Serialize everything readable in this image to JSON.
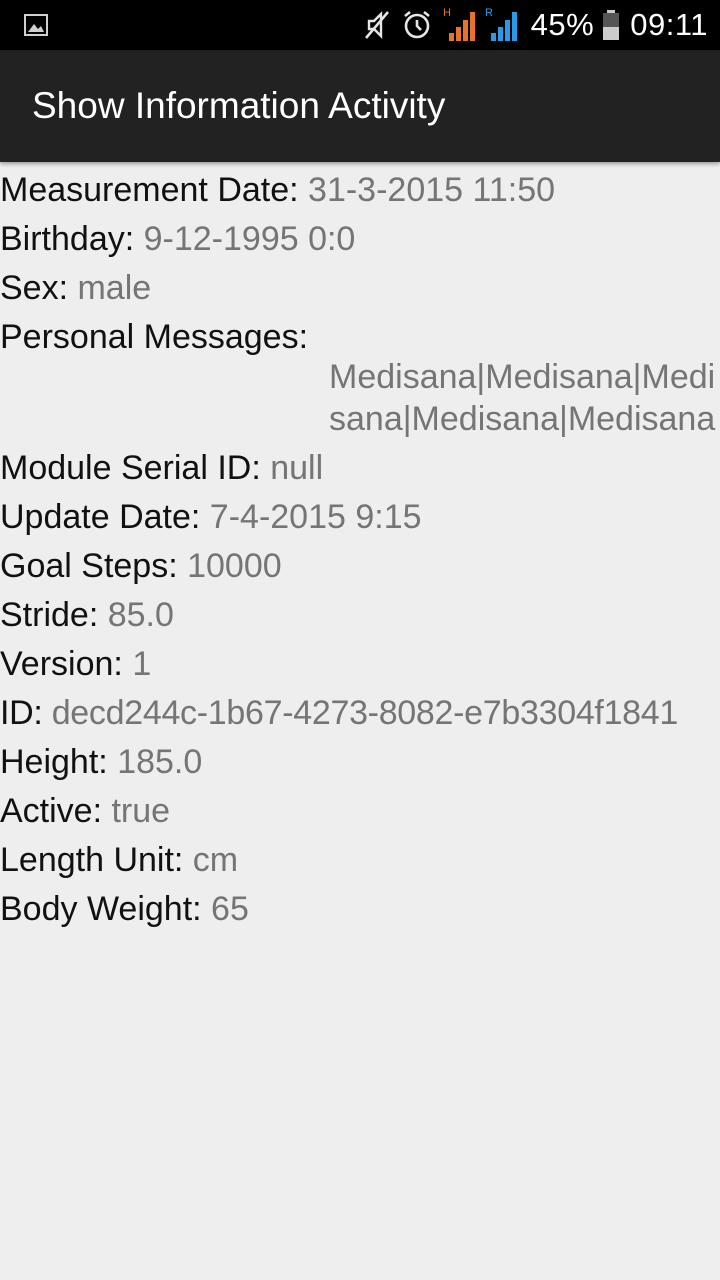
{
  "status_bar": {
    "icons": [
      "image-notification-icon",
      "mute-icon",
      "alarm-icon",
      "signal-h-icon",
      "signal-r-icon",
      "battery-icon"
    ],
    "signal_1_letter": "H",
    "signal_2_letter": "R",
    "battery": "45%",
    "time": "09:11",
    "colors": {
      "signal_1": "#e8742a",
      "signal_2": "#2a9ae8",
      "battery": "#cccccc"
    }
  },
  "action_bar": {
    "title": "Show Information Activity"
  },
  "info": {
    "measurement_date": {
      "label": "Measurement Date: ",
      "value": "31-3-2015 11:50"
    },
    "birthday": {
      "label": "Birthday: ",
      "value": "9-12-1995 0:0"
    },
    "sex": {
      "label": "Sex: ",
      "value": "male"
    },
    "personal_messages": {
      "label": "Personal Messages:",
      "value": "Medisana|Medisana|Medisana|Medisana|Medisana"
    },
    "module_serial_id": {
      "label": "Module Serial ID: ",
      "value": "null"
    },
    "update_date": {
      "label": "Update Date: ",
      "value": "7-4-2015 9:15"
    },
    "goal_steps": {
      "label": "Goal Steps: ",
      "value": "10000"
    },
    "stride": {
      "label": "Stride: ",
      "value": "85.0"
    },
    "version": {
      "label": "Version: ",
      "value": "1"
    },
    "id": {
      "label": "ID: ",
      "value": "decd244c-1b67-4273-8082-e7b3304f1841"
    },
    "height": {
      "label": "Height: ",
      "value": "185.0"
    },
    "active": {
      "label": "Active: ",
      "value": "true"
    },
    "length_unit": {
      "label": "Length Unit: ",
      "value": "cm"
    },
    "body_weight": {
      "label": "Body Weight: ",
      "value": "65"
    }
  }
}
